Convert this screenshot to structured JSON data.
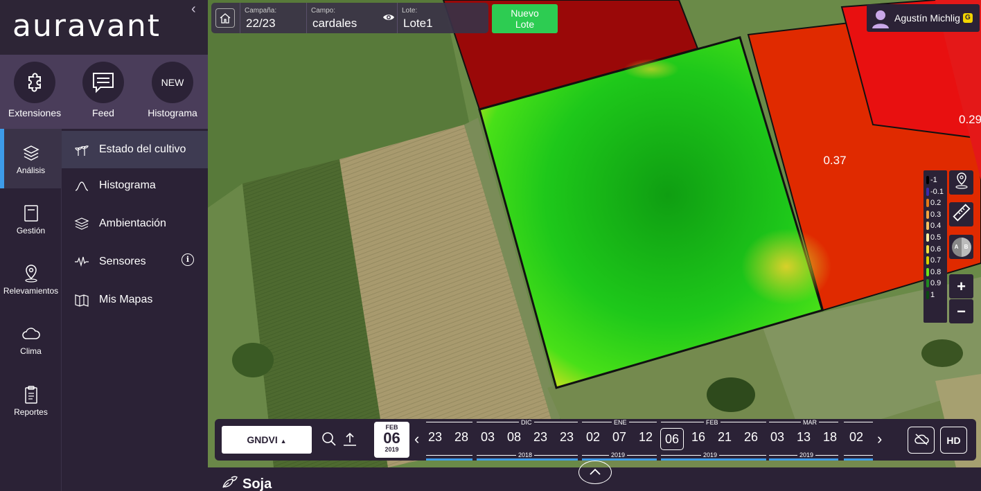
{
  "app": {
    "logo": "auravant",
    "collapse_icon": "chevron-left-icon"
  },
  "quick_bar": {
    "items": [
      {
        "label": "Extensiones",
        "icon": "puzzle-icon"
      },
      {
        "label": "Feed",
        "icon": "chat-icon"
      },
      {
        "label": "Histograma",
        "badge": "NEW"
      }
    ]
  },
  "nav_rail": {
    "items": [
      {
        "label": "Análisis",
        "icon": "layers-icon",
        "active": true
      },
      {
        "label": "Gestión",
        "icon": "notebook-icon"
      },
      {
        "label": "Relevamientos",
        "icon": "map-pin-icon"
      },
      {
        "label": "Clima",
        "icon": "cloud-icon"
      },
      {
        "label": "Reportes",
        "icon": "clipboard-icon"
      }
    ]
  },
  "submenu": {
    "items": [
      {
        "label": "Estado del cultivo",
        "icon": "plant-icon",
        "active": true
      },
      {
        "label": "Histograma",
        "icon": "bell-curve-icon"
      },
      {
        "label": "Ambientación",
        "icon": "layers-icon"
      },
      {
        "label": "Sensores",
        "icon": "signal-icon",
        "info": "i"
      },
      {
        "label": "Mis Mapas",
        "icon": "folded-map-icon"
      }
    ]
  },
  "topbar": {
    "campaign_caption": "Campaña:",
    "campaign_value": "22/23",
    "field_caption": "Campo:",
    "field_value": "cardales",
    "lot_caption": "Lote:",
    "lot_value": "Lote1",
    "new_lot_label_1": "Nuevo",
    "new_lot_label_2": "Lote"
  },
  "user": {
    "name": "Agustín Michlig",
    "badge": "G"
  },
  "map": {
    "lot_values": [
      "0.37",
      "0.29"
    ]
  },
  "legend": {
    "entries": [
      {
        "label": "-1",
        "color": "#000000"
      },
      {
        "label": "-0.1",
        "color": "#3b2ca8"
      },
      {
        "label": "0.2",
        "color": "#e07a1a"
      },
      {
        "label": "0.3",
        "color": "#f2a340"
      },
      {
        "label": "0.4",
        "color": "#f5c060"
      },
      {
        "label": "0.5",
        "color": "#fff0a0"
      },
      {
        "label": "0.6",
        "color": "#f0e040"
      },
      {
        "label": "0.7",
        "color": "#d6d000"
      },
      {
        "label": "0.8",
        "color": "#6ee01a"
      },
      {
        "label": "0.9",
        "color": "#1f8a1f"
      },
      {
        "label": "1",
        "color": "#0a4a12"
      }
    ]
  },
  "tools": {
    "zoom_in": "+",
    "zoom_out": "−",
    "compare_a": "A",
    "compare_b": "B"
  },
  "timeline": {
    "index": "GNDVI",
    "selected_month": "FEB",
    "selected_day": "06",
    "selected_year": "2019",
    "days": [
      "23",
      "28",
      "03",
      "08",
      "23",
      "23",
      "02",
      "07",
      "12",
      "06",
      "16",
      "21",
      "26",
      "03",
      "13",
      "18",
      "02"
    ],
    "selected_index": 9,
    "months": [
      "DIC",
      "ENE",
      "FEB",
      "MAR"
    ],
    "years": [
      "2018",
      "2019",
      "2019",
      "2019"
    ],
    "hd_label": "HD"
  },
  "bottom": {
    "crop": "Soja"
  }
}
